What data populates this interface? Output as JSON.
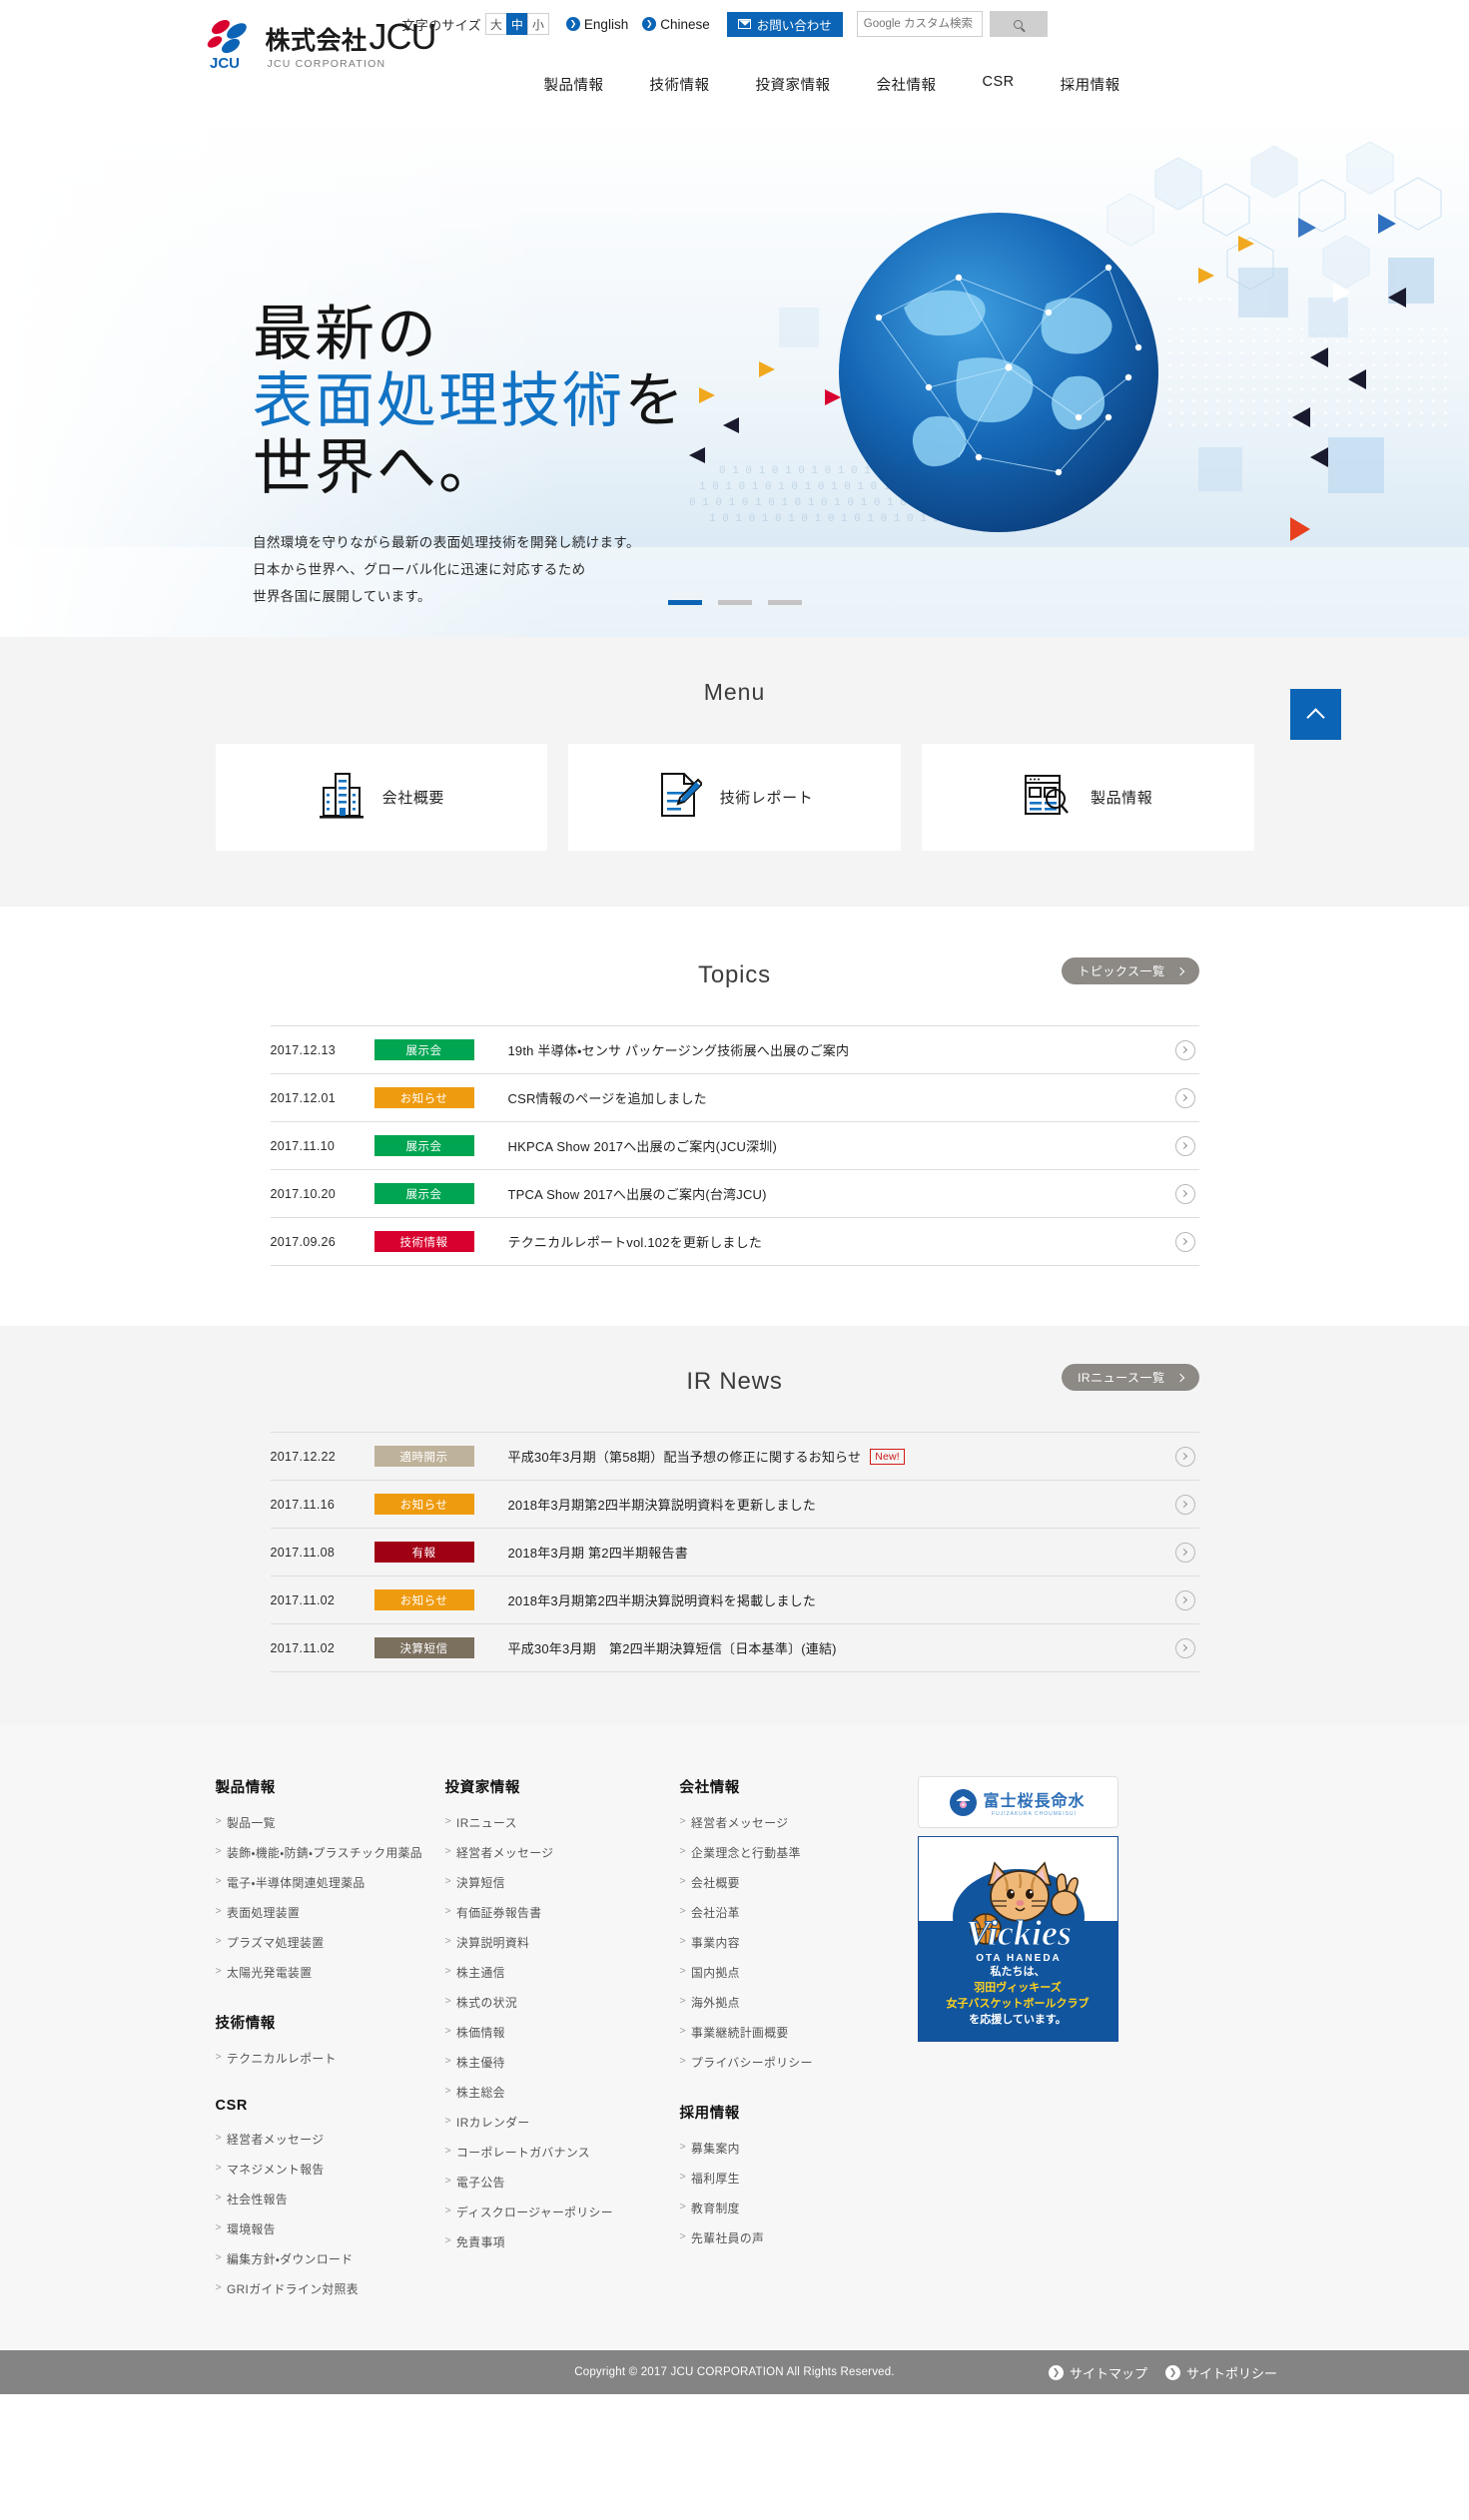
{
  "header": {
    "logo": {
      "company_prefix": "株式会社",
      "company_name": "JCU",
      "sub": "JCU CORPORATION"
    },
    "fontsize_label": "文字のサイズ",
    "fontsize_options": [
      {
        "label": "大",
        "active": false
      },
      {
        "label": "中",
        "active": true
      },
      {
        "label": "小",
        "active": false
      }
    ],
    "english_label": "English",
    "chinese_label": "Chinese",
    "contact_label": "お問い合わせ",
    "search_placeholder": "Google カスタム検索",
    "search_value": "",
    "nav": [
      "製品情報",
      "技術情報",
      "投資家情報",
      "会社情報",
      "CSR",
      "採用情報"
    ]
  },
  "hero": {
    "line1": "最新の",
    "line2_blue": "表面処理技術",
    "line2_black": "を",
    "line3": "世界へ。",
    "desc1": "自然環境を守りながら最新の表面処理技術を開発し続けます。",
    "desc2": "日本から世界へ、グローバル化に迅速に対応するため",
    "desc3": "世界各国に展開しています。",
    "slides": 3,
    "active_slide": 1
  },
  "menu": {
    "title": "Menu",
    "cards": [
      {
        "label": "会社概要",
        "icon": "building-icon"
      },
      {
        "label": "技術レポート",
        "icon": "document-pencil-icon"
      },
      {
        "label": "製品情報",
        "icon": "catalog-search-icon"
      }
    ],
    "pagetop_label": "ページトップへ"
  },
  "topics": {
    "title": "Topics",
    "more_label": "トピックス一覧",
    "rows": [
      {
        "date": "2017.12.13",
        "badge": "展示会",
        "badge_color": "#00a552",
        "text": "19th 半導体・センサ パッケージング技術展へ出展のご案内",
        "new": false
      },
      {
        "date": "2017.12.01",
        "badge": "お知らせ",
        "badge_color": "#ef9b0f",
        "text": "CSR情報のページを追加しました",
        "new": false
      },
      {
        "date": "2017.11.10",
        "badge": "展示会",
        "badge_color": "#00a552",
        "text": "HKPCA Show 2017へ出展のご案内(JCU深圳)",
        "new": false
      },
      {
        "date": "2017.10.20",
        "badge": "展示会",
        "badge_color": "#00a552",
        "text": "TPCA Show 2017へ出展のご案内(台湾JCU)",
        "new": false
      },
      {
        "date": "2017.09.26",
        "badge": "技術情報",
        "badge_color": "#d8002e",
        "text": "テクニカルレポートvol.102を更新しました",
        "new": false
      }
    ]
  },
  "ir": {
    "title": "IR News",
    "more_label": "IRニュース一覧",
    "new_label": "New!",
    "rows": [
      {
        "date": "2017.12.22",
        "badge": "適時開示",
        "badge_color": "#bfb29a",
        "text": "平成30年3月期（第58期）配当予想の修正に関するお知らせ",
        "new": true
      },
      {
        "date": "2017.11.16",
        "badge": "お知らせ",
        "badge_color": "#ef9b0f",
        "text": "2018年3月期第2四半期決算説明資料を更新しました",
        "new": false
      },
      {
        "date": "2017.11.08",
        "badge": "有報",
        "badge_color": "#a00014",
        "text": "2018年3月期 第2四半期報告書",
        "new": false
      },
      {
        "date": "2017.11.02",
        "badge": "お知らせ",
        "badge_color": "#ef9b0f",
        "text": "2018年3月期第2四半期決算説明資料を掲載しました",
        "new": false
      },
      {
        "date": "2017.11.02",
        "badge": "決算短信",
        "badge_color": "#7b6f5e",
        "text": "平成30年3月期　第2四半期決算短信〔日本基準〕(連結)",
        "new": false
      }
    ]
  },
  "footer": {
    "col1": {
      "head1": "製品情報",
      "links1": [
        "製品一覧",
        "装飾・機能・防錆・プラスチック用薬品",
        "電子・半導体関連処理薬品",
        "表面処理装置",
        "プラズマ処理装置",
        "太陽光発電装置"
      ],
      "head2": "技術情報",
      "links2": [
        "テクニカルレポート"
      ],
      "head3": "CSR",
      "links3": [
        "経営者メッセージ",
        "マネジメント報告",
        "社会性報告",
        "環境報告",
        "編集方針・ダウンロード",
        "GRIガイドライン対照表"
      ]
    },
    "col2": {
      "head1": "投資家情報",
      "links1": [
        "IRニュース",
        "経営者メッセージ",
        "決算短信",
        "有価証券報告書",
        "決算説明資料",
        "株主通信",
        "株式の状況",
        "株価情報",
        "株主優待",
        "株主総会",
        "IRカレンダー",
        "コーポレートガバナンス",
        "電子公告",
        "ディスクロージャーポリシー",
        "免責事項"
      ]
    },
    "col3": {
      "head1": "会社情報",
      "links1": [
        "経営者メッセージ",
        "企業理念と行動基準",
        "会社概要",
        "会社沿革",
        "事業内容",
        "国内拠点",
        "海外拠点",
        "事業継続計画概要",
        "プライバシーポリシー"
      ],
      "head2": "採用情報",
      "links2": [
        "募集案内",
        "福利厚生",
        "教育制度",
        "先輩社員の声"
      ]
    },
    "banners": {
      "fuji_title": "富士桜長命水",
      "fuji_sub": "FUJIZAKURA CHOUMEISUI",
      "vickies_logo": "Vickies",
      "vickies_sub": "OTA HANEDA",
      "vickies_line1": "私たちは、",
      "vickies_line2": "羽田ヴィッキーズ",
      "vickies_line3": "女子バスケットボールクラブ",
      "vickies_line4": "を応援しています。"
    },
    "copyright": "Copyright © 2017 JCU CORPORATION All Rights Reserved.",
    "bottom_links": [
      "サイトマップ",
      "サイトポリシー"
    ]
  }
}
